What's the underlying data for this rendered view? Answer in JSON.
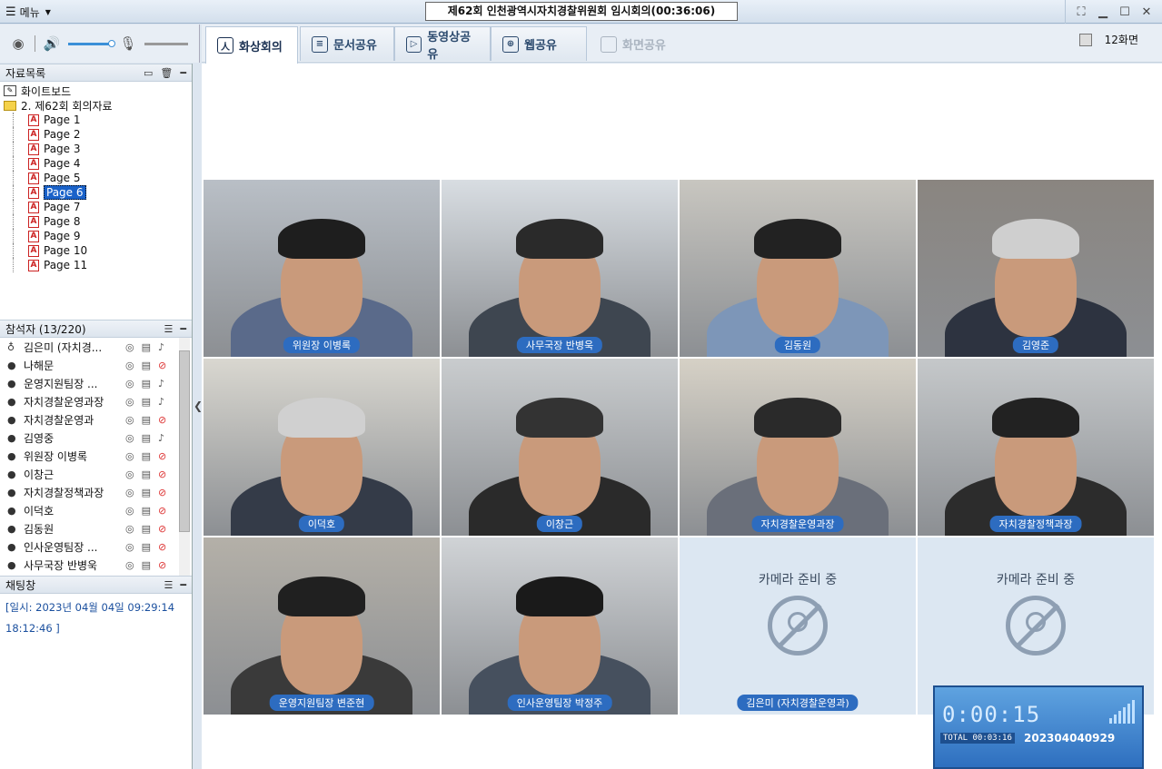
{
  "menu": {
    "label": "메뉴"
  },
  "window": {
    "title": "제62회 인천광역시자치경찰위원회 임시회의(00:36:06)"
  },
  "tabs": [
    {
      "label": "화상회의",
      "active": true,
      "icon": "person-icon"
    },
    {
      "label": "문서공유",
      "active": false,
      "icon": "document-icon"
    },
    {
      "label": "동영상공유",
      "active": false,
      "icon": "play-icon"
    },
    {
      "label": "웹공유",
      "active": false,
      "icon": "globe-icon"
    },
    {
      "label": "화면공유",
      "active": false,
      "disabled": true,
      "icon": "screen-icon"
    }
  ],
  "screens": {
    "label": "12화면"
  },
  "materials": {
    "title": "자료목록",
    "whiteboard": "화이트보드",
    "folder": "2. 제62회 회의자료",
    "pages": [
      "Page 1",
      "Page 2",
      "Page 3",
      "Page 4",
      "Page 5",
      "Page 6",
      "Page 7",
      "Page 8",
      "Page 9",
      "Page 10",
      "Page 11"
    ],
    "selected_page": "Page 6"
  },
  "participants": {
    "title": "참석자 (13/220)",
    "list": [
      {
        "name": "김은미 (자치경...",
        "mic_off": false
      },
      {
        "name": "나해문",
        "mic_off": true
      },
      {
        "name": "운영지원팀장 ...",
        "mic_off": false
      },
      {
        "name": "자치경찰운영과장",
        "mic_off": false
      },
      {
        "name": "자치경찰운영과",
        "mic_off": true
      },
      {
        "name": "김영중",
        "mic_off": false
      },
      {
        "name": "위원장 이병록",
        "mic_off": true
      },
      {
        "name": "이창근",
        "mic_off": true
      },
      {
        "name": "자치경찰정책과장",
        "mic_off": true
      },
      {
        "name": "이덕호",
        "mic_off": true
      },
      {
        "name": "김동원",
        "mic_off": true
      },
      {
        "name": "인사운영팀장 ...",
        "mic_off": true
      },
      {
        "name": "사무국장 반병욱",
        "mic_off": true
      }
    ]
  },
  "chat": {
    "title": "채팅창",
    "line1": "[일시: 2023년 04월 04일 09:29:14",
    "line2": "18:12:46 ]"
  },
  "videos": [
    {
      "label": "위원장 이병록",
      "bg": "#b9bfc6",
      "shirt": "#5a6a8a",
      "hair": "#1e1e1e"
    },
    {
      "label": "사무국장 반병욱",
      "bg": "#d8dde2",
      "shirt": "#3e4650",
      "hair": "#2a2a2a"
    },
    {
      "label": "김동원",
      "bg": "#c8c6c0",
      "shirt": "#7d96b8",
      "hair": "#222"
    },
    {
      "label": "김영준",
      "bg": "#8a8580",
      "shirt": "#2d3340",
      "hair": "#cfcfcf"
    },
    {
      "label": "이덕호",
      "bg": "#d9d7d0",
      "shirt": "#343b48",
      "hair": "#d0d0d0"
    },
    {
      "label": "이창근",
      "bg": "#c9ccce",
      "shirt": "#2a2a2a",
      "hair": "#333"
    },
    {
      "label": "자치경찰운영과장",
      "bg": "#d6d1c6",
      "shirt": "#6a6f7a",
      "hair": "#2a2a2a"
    },
    {
      "label": "자치경찰정책과장",
      "bg": "#c5c8ca",
      "shirt": "#2c2c2c",
      "hair": "#222"
    },
    {
      "label": "운영지원팀장 변준현",
      "bg": "#b4b0a8",
      "shirt": "#3a3a3a",
      "hair": "#202020"
    },
    {
      "label": "인사운영팀장 박정주",
      "bg": "#d0d3d6",
      "shirt": "#46505e",
      "hair": "#1a1a1a"
    },
    {
      "label": "김은미 (자치경찰운영과)",
      "empty": true,
      "empty_text": "카메라 준비 중"
    },
    {
      "label": "",
      "empty": true,
      "empty_text": "카메라 준비 중"
    }
  ],
  "timer": {
    "elapsed": "0:00:15",
    "total": "TOTAL 00:03:16",
    "id": "202304040929"
  }
}
